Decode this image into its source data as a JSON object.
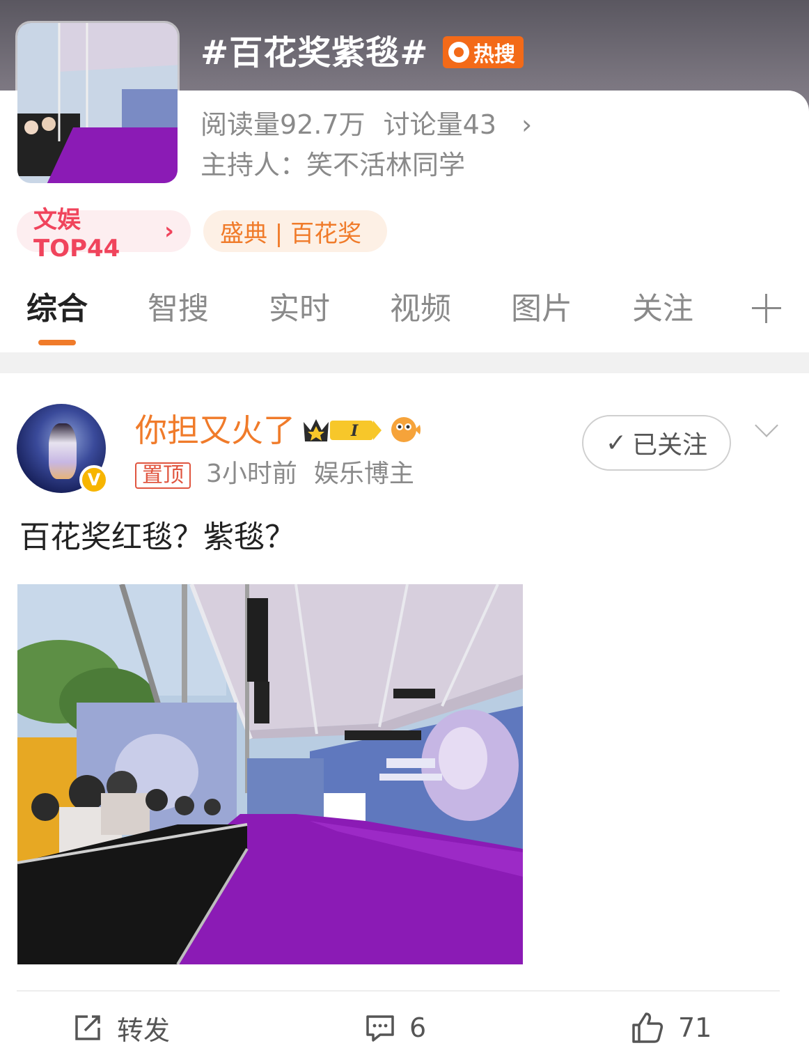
{
  "topic": {
    "title": "#百花奖紫毯#",
    "badge": "热搜",
    "reads_label": "阅读量",
    "reads_value": "92.7万",
    "discussion_label": "讨论量",
    "discussion_value": "43",
    "host_label": "主持人：",
    "host_name": "笑不活林同学",
    "rank_pill": "文娱TOP44",
    "category_pill": "盛典 | 百花奖"
  },
  "tabs": [
    "综合",
    "智搜",
    "实时",
    "视频",
    "图片",
    "关注"
  ],
  "active_tab": "综合",
  "post": {
    "username": "你担又火了",
    "level_badge": "I",
    "pin_label": "置顶",
    "time": "3小时前",
    "role": "娱乐博主",
    "follow_label": "已关注",
    "text": "百花奖红毯？紫毯？"
  },
  "actions": {
    "repost_label": "转发",
    "comment_count": "6",
    "like_count": "71"
  },
  "colors": {
    "accent_orange": "#f07b2a",
    "hot_badge": "#f36a18",
    "rank_pink": "#f0445c",
    "carpet_purple": "#8b1bb5"
  }
}
